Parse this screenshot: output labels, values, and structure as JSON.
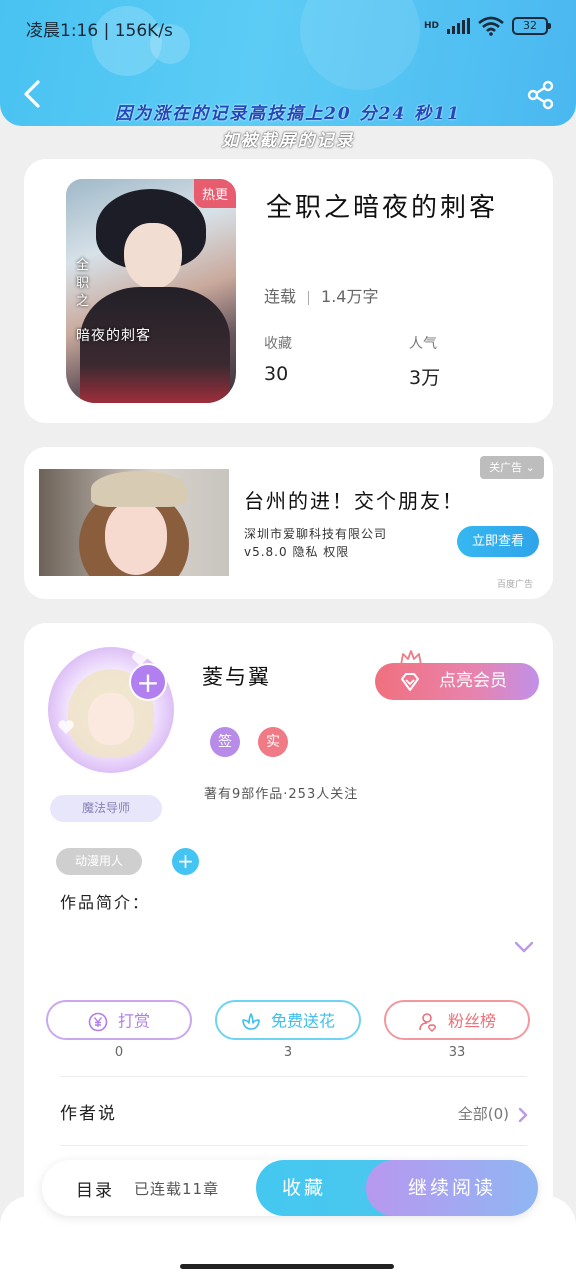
{
  "status_bar": {
    "time": "凌晨1:16 | 156K/s",
    "network": "HD",
    "battery": "32"
  },
  "header": {
    "marquee_line1": "因为涨在的记录高技搞上20 分24 秒11",
    "marquee_line2": "如被截屏的记录"
  },
  "book": {
    "cover_badge": "热更",
    "cover_title": "暗夜的刺客",
    "cover_vertical": "全职之",
    "title": "全职之暗夜的刺客",
    "status": "连载",
    "word_count": "1.4万字",
    "favorites_label": "收藏",
    "favorites_value": "30",
    "popularity_label": "人气",
    "popularity_value": "3万"
  },
  "ad": {
    "close_label": "关广告",
    "headline": "台州的进！交个朋友！",
    "company": "深圳市爱聊科技有限公司",
    "version": "v5.8.0 隐私 权限",
    "cta": "立即查看",
    "tag": "百度广告"
  },
  "author": {
    "name": "菱与翼",
    "vip_button": "点亮会员",
    "badge_sign": "签",
    "badge_real": "实",
    "stats": "著有9部作品·253人关注",
    "avatar_label": "魔法导师",
    "reader_tag": "动漫用人",
    "intro_label": "作品简介：",
    "actions": [
      {
        "label": "打赏",
        "count": "0"
      },
      {
        "label": "免费送花",
        "count": "3"
      },
      {
        "label": "粉丝榜",
        "count": "33"
      }
    ],
    "says_label": "作者说",
    "says_all": "全部(0)"
  },
  "bottom_bar": {
    "toc": "目录",
    "chapters": "已连载11章",
    "favorite": "收藏",
    "continue": "继续阅读"
  },
  "colors": {
    "header": "#49c2f2",
    "purple": "#b27ff0",
    "cyan": "#44c4f2",
    "coral": "#f0707e"
  }
}
